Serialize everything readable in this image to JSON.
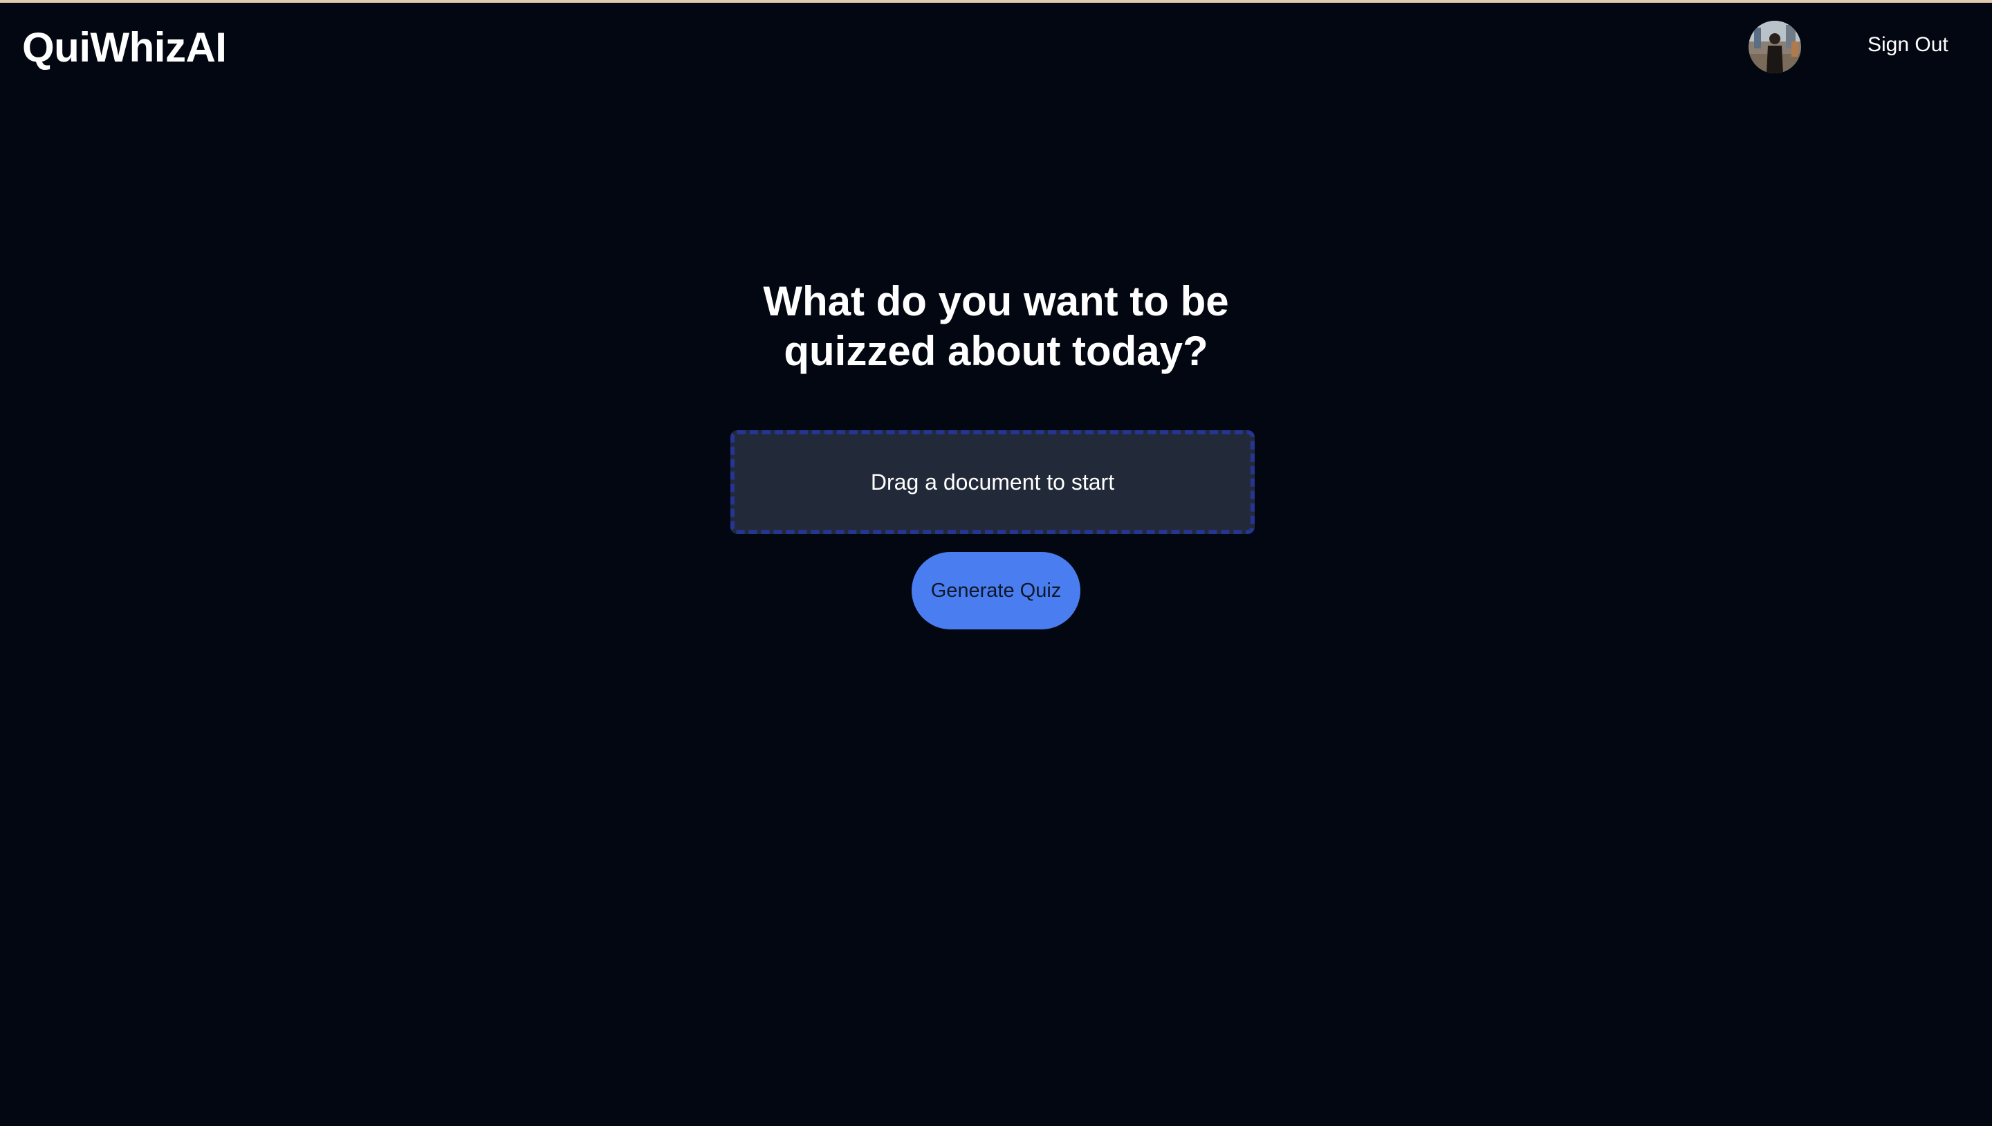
{
  "header": {
    "logo_text": "QuiWhizAI",
    "avatar_alt": "User avatar",
    "signout_label": "Sign Out"
  },
  "main": {
    "title": "What do you want to be quizzed about today?",
    "dropzone_text": "Drag a document to start",
    "generate_label": "Generate Quiz"
  },
  "colors": {
    "background": "#030712",
    "top_strip": "#e3cbb0",
    "dropzone_bg": "#222a3a",
    "dropzone_border": "#263592",
    "button": "#4a7ef0",
    "button_text": "#0f172a"
  }
}
